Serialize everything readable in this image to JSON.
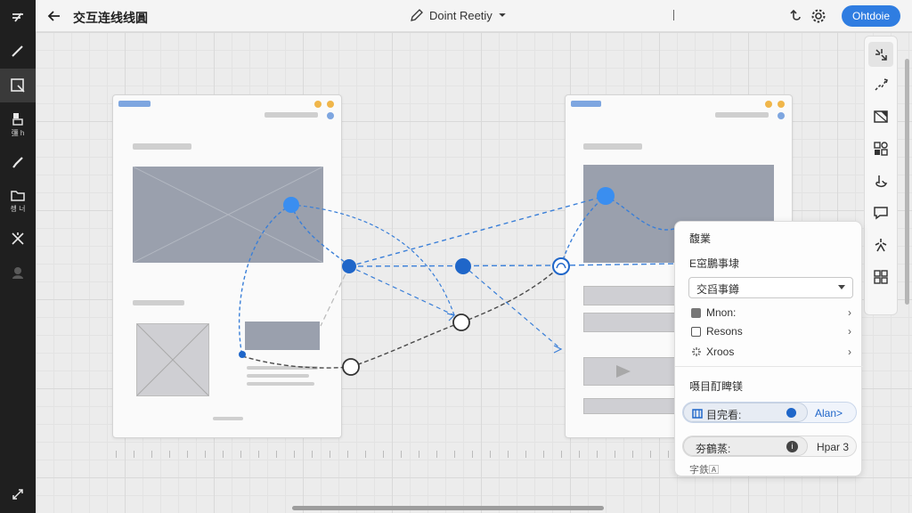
{
  "header": {
    "title": "交互连线线圓",
    "mode_label": "Doint Reetiy",
    "publish_label": "Ohtdoie"
  },
  "sidebar": {
    "items": [
      {
        "icon": "logo-icon",
        "label": ""
      },
      {
        "icon": "pen-icon",
        "label": ""
      },
      {
        "icon": "select-frame-icon",
        "label": ""
      },
      {
        "icon": "layers-icon",
        "label": "彊 h"
      },
      {
        "icon": "brush-icon",
        "label": ""
      },
      {
        "icon": "folder-icon",
        "label": "쇙 너"
      },
      {
        "icon": "magic-icon",
        "label": ""
      },
      {
        "icon": "avatar-icon",
        "label": ""
      },
      {
        "icon": "expand-icon",
        "label": ""
      }
    ]
  },
  "panel": {
    "section_title": "馥業",
    "interaction_heading": "E窋鵬事埭",
    "trigger_value": "交舀事鐏",
    "options": [
      "Mnon:",
      "Resons",
      "Xroos"
    ],
    "target_heading": "嗫目酊睥镁",
    "target_row": {
      "label": "目完看:",
      "value": "Alan>"
    },
    "delay_row": {
      "label": "夯鶴蒸:",
      "value": "Hpar 3"
    },
    "footer_text": "字鉄🄰"
  },
  "colors": {
    "accent": "#2f7de1",
    "wire_blue": "#3a7fd8",
    "wire_dark": "#4a4a4a",
    "placeholder": "#9aa0ad"
  }
}
